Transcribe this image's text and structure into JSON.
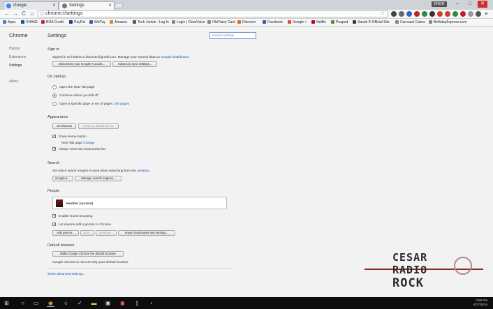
{
  "window": {
    "tabs": [
      {
        "label": "Google",
        "favicon": "google-icon"
      },
      {
        "label": "Settings",
        "favicon": "gear-icon"
      }
    ],
    "user_chip": "ERGN",
    "controls": {
      "minimize": "–",
      "maximize": "□",
      "close": "✕"
    }
  },
  "toolbar": {
    "url": "chrome://settings",
    "back": "←",
    "forward": "→",
    "reload": "C",
    "home": "⌂",
    "star": "☆"
  },
  "bookmarks": [
    {
      "label": "Apps",
      "color": "#4a7bd0"
    },
    {
      "label": "CHASE",
      "color": "#1b4e9b"
    },
    {
      "label": "BOA Credit",
      "color": "#c0242a"
    },
    {
      "label": "PayPal",
      "color": "#1f3a8a"
    },
    {
      "label": "WePay",
      "color": "#3a5bb0"
    },
    {
      "label": "Amazon",
      "color": "#e08a1e"
    },
    {
      "label": "Tech Junkie - Log In",
      "color": "#555555"
    },
    {
      "label": "Login | ClearVoice",
      "color": "#888888"
    },
    {
      "label": "Old Navy Card",
      "color": "#888888"
    },
    {
      "label": "Discover",
      "color": "#e36b1b"
    },
    {
      "label": "Facebook",
      "color": "#3b5998"
    },
    {
      "label": "Google +",
      "color": "#dd4b39"
    },
    {
      "label": "Netflix",
      "color": "#b20710"
    },
    {
      "label": "Peapod",
      "color": "#5c8a2e"
    },
    {
      "label": "Sanuk ® Official Site",
      "color": "#333333"
    },
    {
      "label": "Carousel Cakes",
      "color": "#888888"
    },
    {
      "label": "BirthdayExpress.com",
      "color": "#888888"
    }
  ],
  "nav": {
    "title": "Chrome",
    "items": [
      "History",
      "Extensions",
      "Settings",
      "About"
    ]
  },
  "settings": {
    "title": "Settings",
    "search_placeholder": "Search settings",
    "signin": {
      "heading": "Sign in",
      "text_prefix": "Signed in as heather.a.bloomer@gmail.com. Manage your synced data on",
      "link": "Google Dashboard",
      "text_suffix": ".",
      "disconnect": "Disconnect your Google Account...",
      "advanced_sync": "Advanced sync settings..."
    },
    "startup": {
      "heading": "On startup",
      "options": [
        "Open the New Tab page",
        "Continue where you left off",
        "Open a specific page or set of pages."
      ],
      "set_pages": "Set pages"
    },
    "appearance": {
      "heading": "Appearance",
      "get_themes": "Get themes",
      "reset_theme": "Reset to default theme",
      "show_home": "Show Home button",
      "new_tab_page": "New Tab page",
      "change": "Change",
      "show_bookmarks": "Always show the bookmarks bar"
    },
    "search": {
      "heading": "Search",
      "text": "Set which search engine is used when searching from the",
      "link": "omnibox",
      "text_suffix": ".",
      "engine": "Google",
      "manage": "Manage search engines..."
    },
    "people": {
      "heading": "People",
      "profile": "Heather (current)",
      "guest": "Enable Guest browsing",
      "anyone": "Let anyone add a person to Chrome",
      "add": "Add person...",
      "edit": "Edit...",
      "remove": "Remove...",
      "import": "Import bookmarks and settings..."
    },
    "default_browser": {
      "heading": "Default browser",
      "make_default": "Make Google Chrome the default browser",
      "status": "Google Chrome is not currently your default browser."
    },
    "show_advanced": "Show advanced settings..."
  },
  "watermark": {
    "line1": "CESAR",
    "line2": "RADIO",
    "line3": "ROCK"
  },
  "taskbar": {
    "time": "3:59 PM",
    "date": "4/17/2016"
  }
}
